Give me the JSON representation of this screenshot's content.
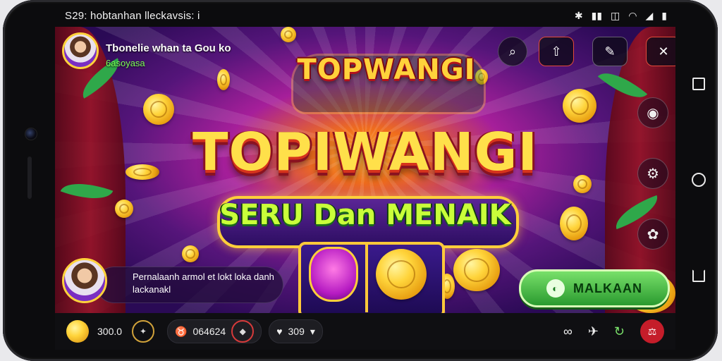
{
  "status_bar": {
    "left_text": "S29: hobtanhan lleckavsis: i",
    "icons": [
      "bluetooth-icon",
      "signal-icon",
      "vibrate-icon",
      "wifi-icon",
      "signal-bars-icon",
      "battery-icon"
    ]
  },
  "profile": {
    "name": "Tbonelie whan ta Gou ko",
    "subtitle": "6asoyasa"
  },
  "game": {
    "title_top": "TOPWANGI",
    "title_main": "TOPIWANGI",
    "subtitle": "SERU Dan MENAIK"
  },
  "top_controls": {
    "search_icon": "search-icon",
    "buttons": [
      "share-icon",
      "edit-icon",
      "close-icon"
    ]
  },
  "side_controls": [
    "settings-icon",
    "gear-icon",
    "help-icon"
  ],
  "message": {
    "text": "Pernalaanh armol et lokt loka danh lackanakl"
  },
  "cta": {
    "label": "MALKAAN"
  },
  "bottom_bar": {
    "coins_value": "300.0",
    "bet_value": "064624",
    "lives_value": "309"
  },
  "nav_bar": [
    "recents-icon",
    "home-icon",
    "back-icon"
  ]
}
